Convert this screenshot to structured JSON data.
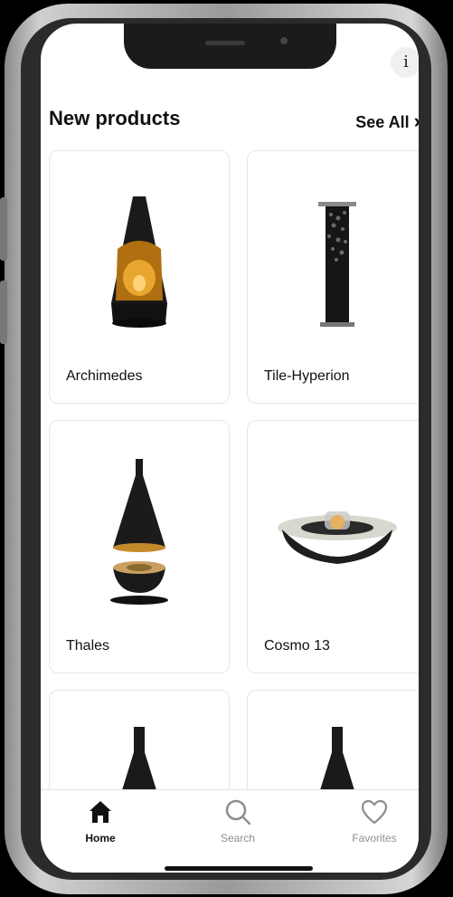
{
  "section": {
    "title": "New products",
    "see_all": "See All",
    "see_all_chevron": "›"
  },
  "info_button": {
    "label": "i"
  },
  "products": [
    {
      "name": "Archimedes"
    },
    {
      "name": "Tile-Hyperion"
    },
    {
      "name": "Thales"
    },
    {
      "name": "Cosmo 13"
    }
  ],
  "tabs": [
    {
      "label": "Home",
      "icon": "home-icon",
      "active": true
    },
    {
      "label": "Search",
      "icon": "search-icon",
      "active": false
    },
    {
      "label": "Favorites",
      "icon": "heart-icon",
      "active": false
    }
  ],
  "colors": {
    "active_tab": "#111111",
    "inactive_tab": "#8e8e8e",
    "accent_gold": "#d9a23a"
  }
}
